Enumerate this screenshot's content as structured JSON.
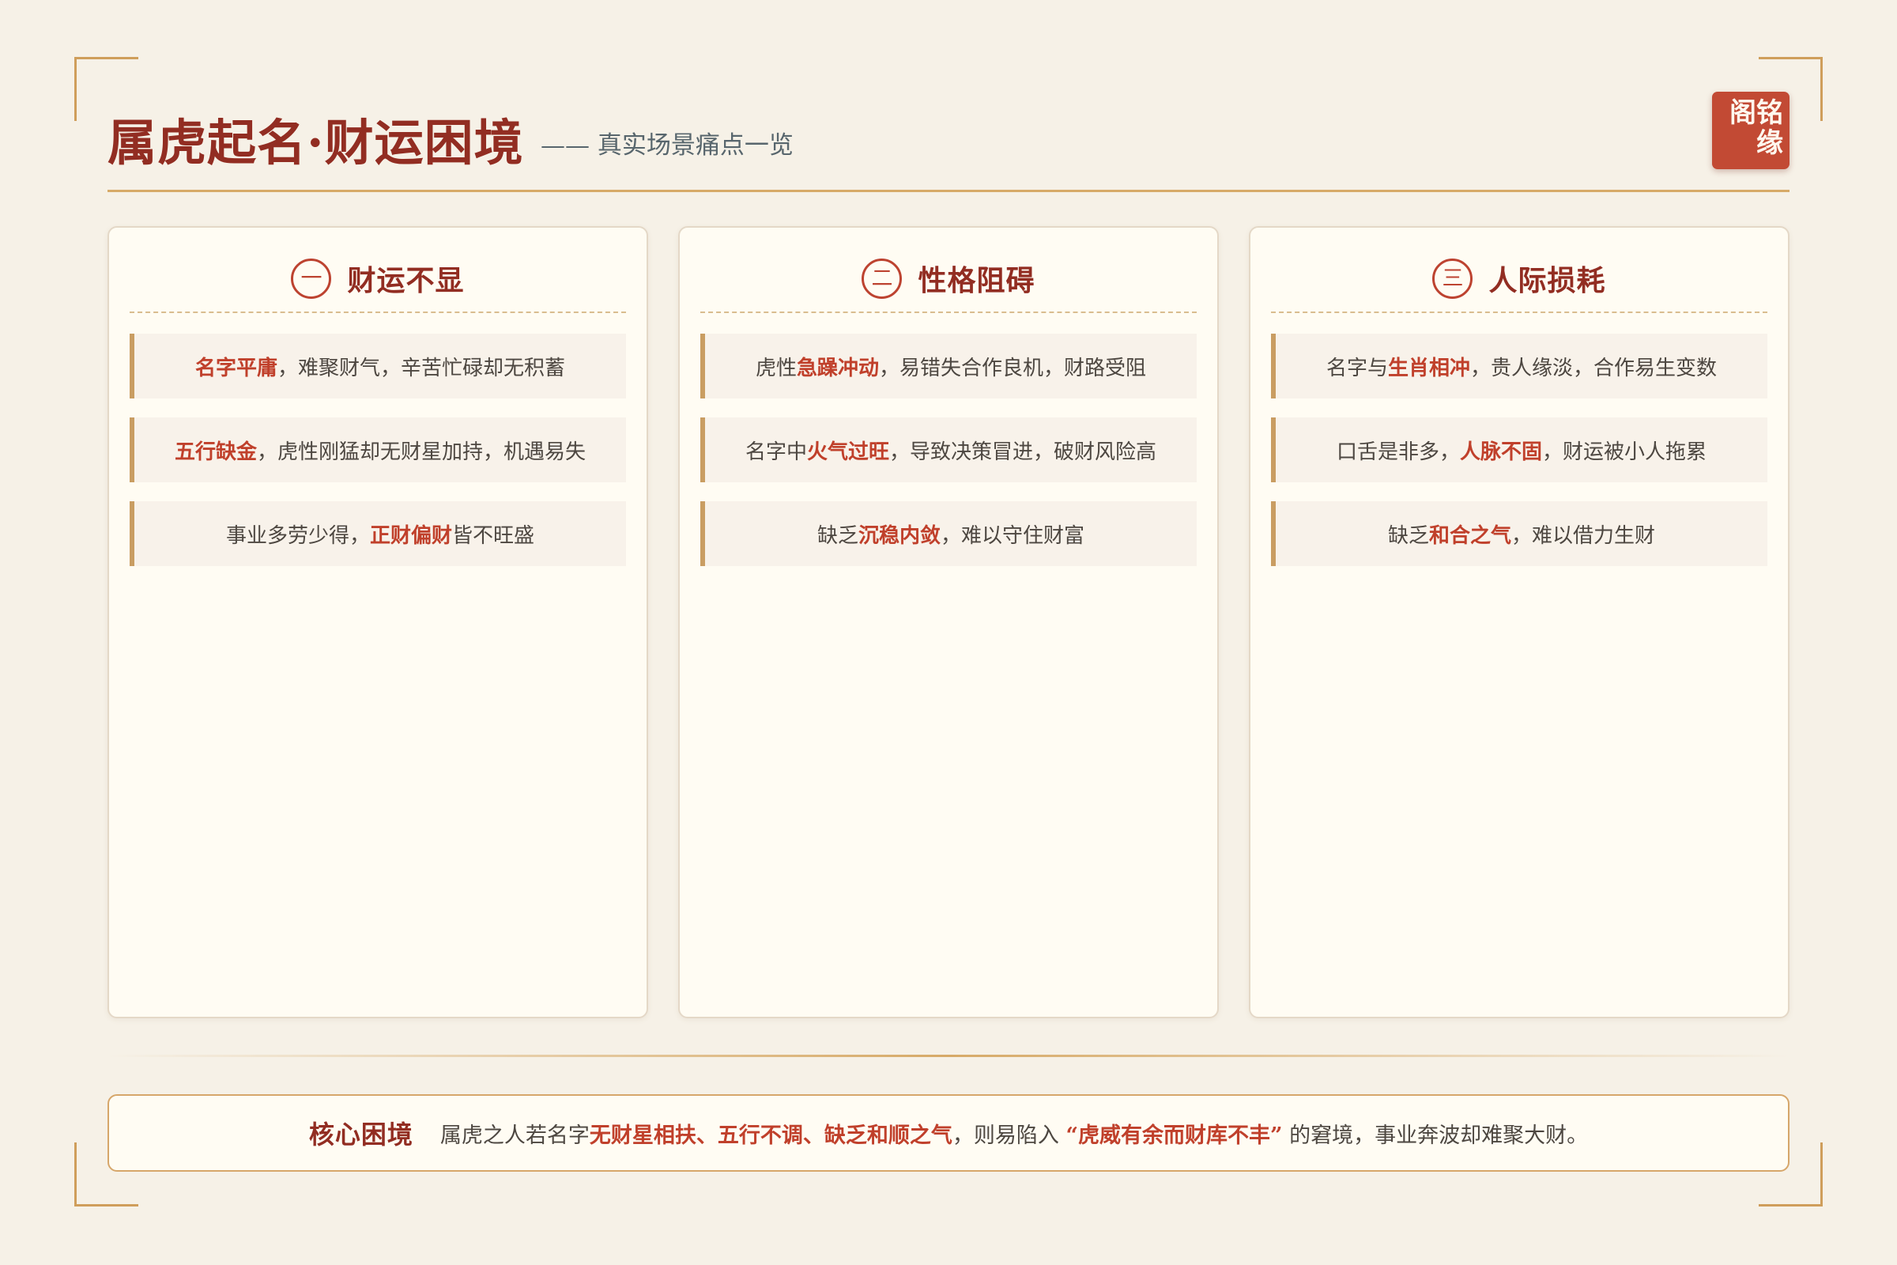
{
  "header": {
    "title": "属虎起名·财运困境",
    "subtitle": "—— 真实场景痛点一览",
    "seal": "阁铭缘"
  },
  "cards": [
    {
      "numeral": "一",
      "title": "财运不显",
      "items": [
        {
          "before": "",
          "highlight": "名字平庸",
          "after": "，难聚财气，辛苦忙碌却无积蓄"
        },
        {
          "before": "",
          "highlight": "五行缺金",
          "after": "，虎性刚猛却无财星加持，机遇易失"
        },
        {
          "before": "事业多劳少得，",
          "highlight": "正财偏财",
          "after": " 皆不旺盛"
        }
      ]
    },
    {
      "numeral": "二",
      "title": "性格阻碍",
      "items": [
        {
          "before": "虎性",
          "highlight": "急躁冲动",
          "after": "，易错失合作良机，财路受阻"
        },
        {
          "before": "名字中",
          "highlight": "火气过旺",
          "after": "，导致决策冒进，破财风险高"
        },
        {
          "before": "缺乏",
          "highlight": "沉稳内敛",
          "after": "，难以守住财富"
        }
      ]
    },
    {
      "numeral": "三",
      "title": "人际损耗",
      "items": [
        {
          "before": "名字与",
          "highlight": "生肖相冲",
          "after": "，贵人缘淡，合作易生变数"
        },
        {
          "before": "口舌是非多，",
          "highlight": "人脉不固",
          "after": "，财运被小人拖累"
        },
        {
          "before": "缺乏",
          "highlight": "和合之气",
          "after": "，难以借力生财"
        }
      ]
    }
  ],
  "summary": {
    "label": "核心困境",
    "before": "属虎之人若名字",
    "highlight1": "无财星相扶、五行不调、缺乏和顺之气",
    "middle": "，则易陷入 ",
    "highlight2": "“虎威有余而财库不丰”",
    "after": " 的窘境，事业奔波却难聚大财。"
  }
}
